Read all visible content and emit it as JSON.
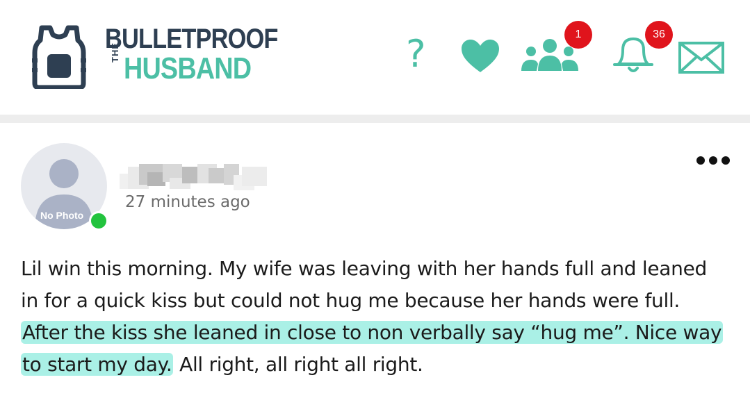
{
  "header": {
    "logo": {
      "line1": "BULLETPROOF",
      "the": "THE",
      "line2": "HUSBAND"
    },
    "icons": {
      "help": "?",
      "friends_badge": "1",
      "notifications_badge": "36"
    }
  },
  "colors": {
    "brand_dark": "#2e3f52",
    "brand_teal": "#4cbfa5",
    "badge_red": "#e0141c",
    "highlight": "#aaf0e6",
    "online_green": "#22c33e"
  },
  "post": {
    "avatar_label": "No Photo",
    "timestamp": "27 minutes ago",
    "text_before": "Lil win this morning. My wife was leaving with her hands full and leaned in for a quick kiss but could not hug me because her hands were full. ",
    "text_highlighted": "After the kiss she leaned in close to non verbally say “hug me”.  Nice way to start my day.",
    "text_after": " All right, all right all right."
  }
}
